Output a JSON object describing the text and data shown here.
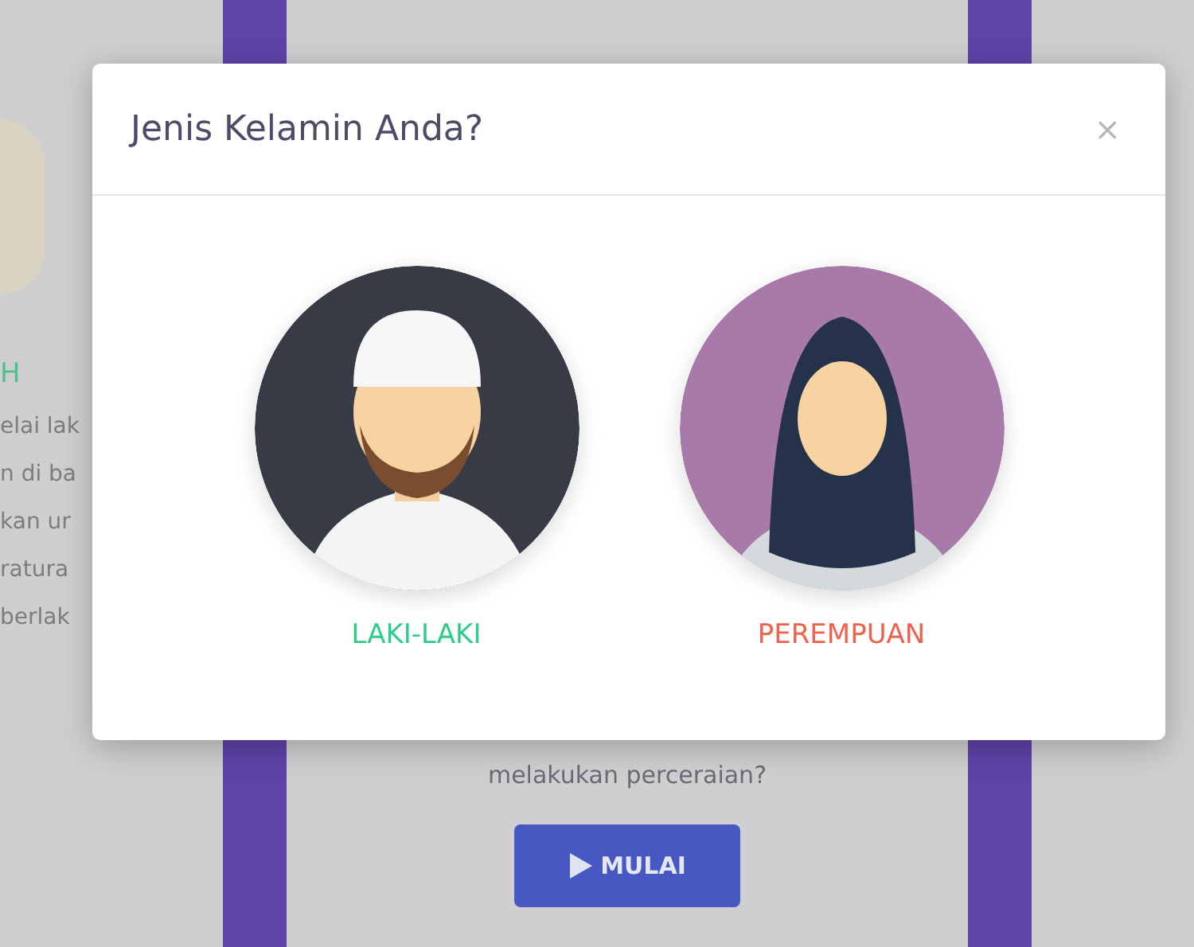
{
  "background": {
    "heading": "H",
    "lines": [
      "elai lak",
      "n di ba",
      "kan ur",
      "ratura",
      "berlak"
    ],
    "question": "melakukan perceraian?",
    "start_button": {
      "label": "MULAI"
    }
  },
  "modal": {
    "title": "Jenis Kelamin Anda?",
    "close": "×",
    "options": [
      {
        "kind": "male",
        "label": "LAKI-LAKI",
        "color": "#2ecc8a"
      },
      {
        "kind": "female",
        "label": "PEREMPUAN",
        "color": "#f0624d"
      }
    ]
  }
}
